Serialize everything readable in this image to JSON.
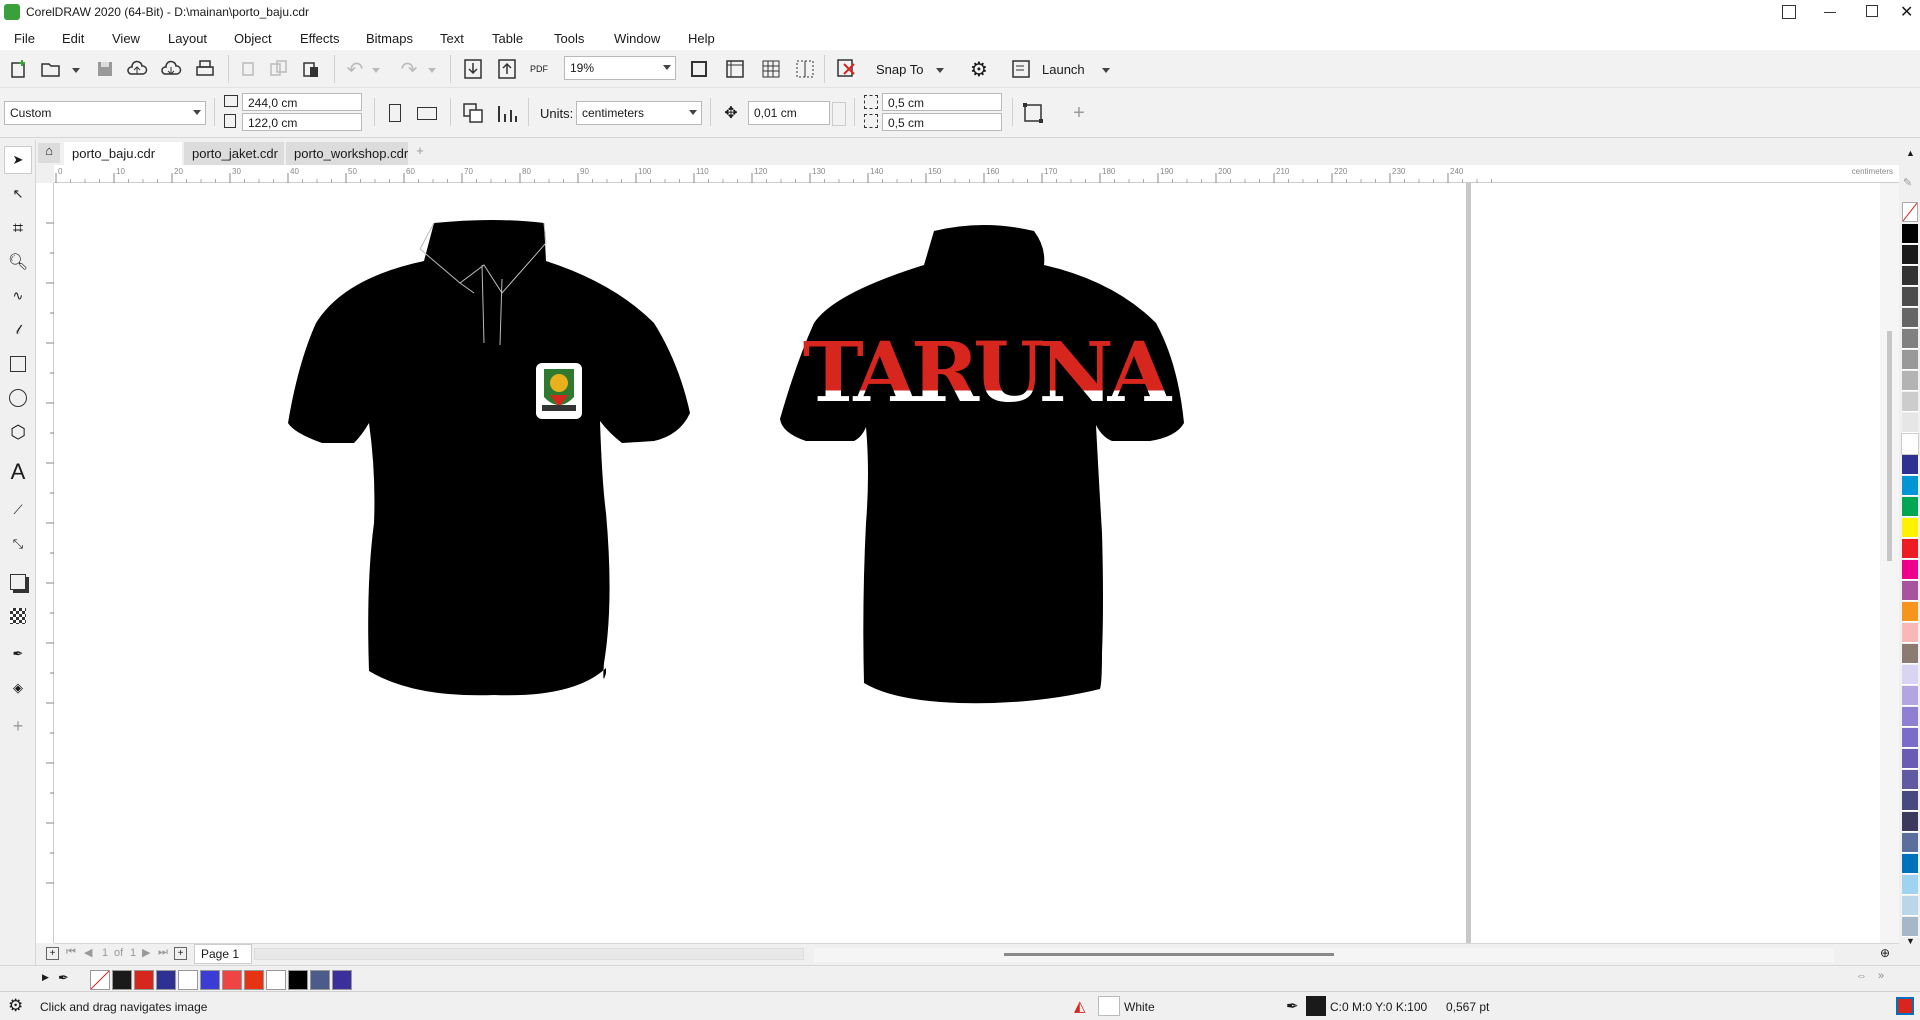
{
  "window": {
    "title": "CorelDRAW 2020 (64-Bit) - D:\\mainan\\porto_baju.cdr"
  },
  "menu": [
    "File",
    "Edit",
    "View",
    "Layout",
    "Object",
    "Effects",
    "Bitmaps",
    "Text",
    "Table",
    "Tools",
    "Window",
    "Help"
  ],
  "toolbar": {
    "zoom_value": "19%",
    "pdf_label": "PDF",
    "snap_label": "Snap To",
    "launch_label": "Launch"
  },
  "property_bar": {
    "preset": "Custom",
    "width": "244,0 cm",
    "height": "122,0 cm",
    "units_label": "Units:",
    "units_value": "centimeters",
    "nudge": "0,01 cm",
    "dup_x": "0,5 cm",
    "dup_y": "0,5 cm"
  },
  "tabs": [
    "porto_baju.cdr",
    "porto_jaket.cdr",
    "porto_workshop.cdr"
  ],
  "ruler": {
    "h_ticks": [
      "0",
      "10",
      "20",
      "30",
      "40",
      "50",
      "60",
      "70",
      "80",
      "90",
      "100",
      "110",
      "120",
      "130",
      "140",
      "150",
      "160",
      "170",
      "180",
      "190",
      "200",
      "210",
      "220",
      "230",
      "240"
    ],
    "unit": "centimeters"
  },
  "artwork": {
    "back_text": "TARUNA"
  },
  "pagebar": {
    "current": "1",
    "of_label": "of",
    "total": "1",
    "page_tab": "Page 1"
  },
  "status": {
    "hint": "Click and drag navigates image",
    "fill_name": "White",
    "outline_info": "C:0 M:0 Y:0 K:100",
    "outline_width": "0,567 pt"
  },
  "colors": {
    "shirt": "#000000",
    "taruna_red": "#d7261e",
    "accent_green": "#3aa13a"
  },
  "palette_colors": [
    "#000000",
    "#1a1a1a",
    "#333333",
    "#4d4d4d",
    "#666666",
    "#808080",
    "#999999",
    "#b3b3b3",
    "#cccccc",
    "#e6e6e6",
    "#ffffff",
    "#2e3192",
    "#0096d6",
    "#00a651",
    "#fff200",
    "#ed1c24",
    "#ec008c",
    "#a8539e",
    "#f7941d",
    "#f9b8b8",
    "#8c7b70",
    "#d9d4f2",
    "#b3a6e0",
    "#8f7fd0",
    "#7a6cc8",
    "#6a5bb5",
    "#5f5aa2",
    "#48497e",
    "#3a3a5c",
    "#5a6f9c",
    "#0072bc",
    "#9fd3f0",
    "#b9d7e8",
    "#a6b8c8"
  ],
  "document_palette": [
    "#1a1a1a",
    "#d7261e",
    "#2e3192",
    "#ffffff",
    "#3b3bd6",
    "#ef4444",
    "#e63312",
    "#ffffff",
    "#000000",
    "#4a5b8c",
    "#3a2f9b"
  ]
}
